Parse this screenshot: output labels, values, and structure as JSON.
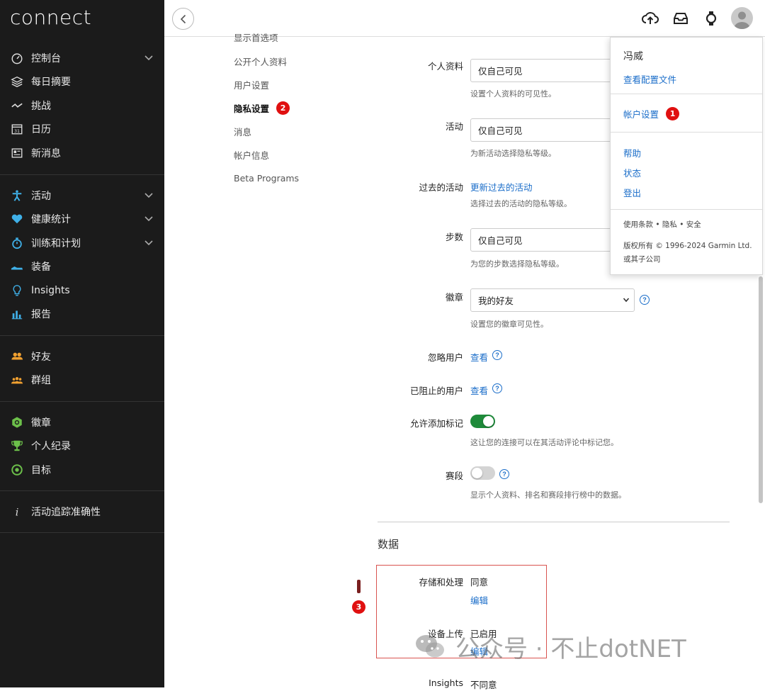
{
  "app": {
    "logo": "connect"
  },
  "sidebar": {
    "group1": [
      {
        "label": "控制台",
        "icon": "dashboard-icon",
        "chevron": true
      },
      {
        "label": "每日摘要",
        "icon": "layers-icon",
        "chevron": false
      },
      {
        "label": "挑战",
        "icon": "challenge-icon",
        "chevron": false
      },
      {
        "label": "日历",
        "icon": "calendar-icon",
        "chevron": false
      },
      {
        "label": "新消息",
        "icon": "news-icon",
        "chevron": false
      }
    ],
    "group2": [
      {
        "label": "活动",
        "icon": "activity-icon",
        "chevron": true
      },
      {
        "label": "健康统计",
        "icon": "heart-icon",
        "chevron": true
      },
      {
        "label": "训练和计划",
        "icon": "stopwatch-icon",
        "chevron": true
      },
      {
        "label": "装备",
        "icon": "shoe-icon",
        "chevron": false
      },
      {
        "label": "Insights",
        "icon": "lightbulb-icon",
        "chevron": false
      },
      {
        "label": "报告",
        "icon": "bar-chart-icon",
        "chevron": false
      }
    ],
    "group3": [
      {
        "label": "好友",
        "icon": "friends-icon",
        "chevron": false
      },
      {
        "label": "群组",
        "icon": "groups-icon",
        "chevron": false
      }
    ],
    "group4": [
      {
        "label": "徽章",
        "icon": "badge-icon",
        "chevron": false
      },
      {
        "label": "个人纪录",
        "icon": "trophy-icon",
        "chevron": false
      },
      {
        "label": "目标",
        "icon": "target-icon",
        "chevron": false
      }
    ],
    "group5": [
      {
        "label": "活动追踪准确性",
        "icon": "info-icon",
        "chevron": false
      }
    ]
  },
  "settings_menu": {
    "items": [
      "显示首选项",
      "公开个人资料",
      "用户设置",
      "隐私设置",
      "消息",
      "帐户信息",
      "Beta Programs"
    ],
    "active_index": 3,
    "active_badge": "2"
  },
  "privacy": {
    "profile_label": "个人资料",
    "profile_value": "仅自己可见",
    "profile_help": "设置个人资料的可见性。",
    "activity_label": "活动",
    "activity_value": "仅自己可见",
    "activity_help": "为新活动选择隐私等级。",
    "past_activity_label": "过去的活动",
    "past_activity_link": "更新过去的活动",
    "past_activity_help": "选择过去的活动的隐私等级。",
    "steps_label": "步数",
    "steps_value": "仅自己可见",
    "steps_help": "为您的步数选择隐私等级。",
    "badges_label": "徽章",
    "badges_value": "我的好友",
    "badges_help": "设置您的徽章可见性。",
    "ignored_label": "忽略用户",
    "ignored_link": "查看",
    "blocked_label": "已阻止的用户",
    "blocked_link": "查看",
    "tagging_label": "允许添加标记",
    "tagging_on": true,
    "tagging_help": "这让您的连接可以在其活动评论中标记您。",
    "segments_label": "赛段",
    "segments_on": false,
    "segments_help": "显示个人资料、排名和赛段排行榜中的数据。"
  },
  "data_section": {
    "title": "数据",
    "storage_label": "存储和处理",
    "storage_value": "同意",
    "storage_link": "编辑",
    "upload_label": "设备上传",
    "upload_value": "已启用",
    "upload_link": "编辑",
    "insights_label": "Insights",
    "insights_value": "不同意",
    "annotation_badge": "3"
  },
  "account_dropdown": {
    "user_name": "冯威",
    "view_profile": "查看配置文件",
    "account_settings": "帐户设置",
    "account_badge": "1",
    "help": "帮助",
    "status": "状态",
    "logout": "登出",
    "legal": "使用条款 • 隐私 • 安全",
    "copyright": "版权所有 © 1996-2024 Garmin Ltd. 或其子公司"
  },
  "watermark": {
    "text": "公众号 · 不止dotNET"
  },
  "colors": {
    "accent": "#1a6dc9",
    "toggle_on": "#1e8a3a",
    "badge": "#e01010",
    "sidebar_bg": "#1b1b1b"
  }
}
